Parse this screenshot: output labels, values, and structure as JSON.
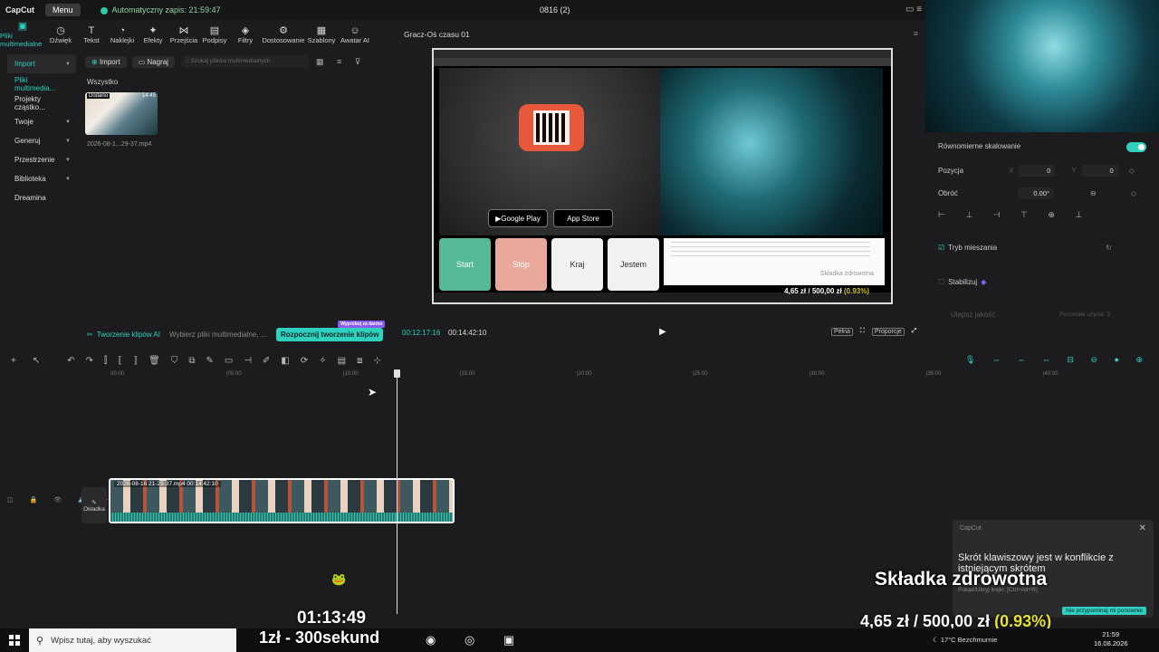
{
  "app": {
    "logo": "CapCut",
    "menu_label": "Menu",
    "autosave": "Automatyczny zapis: 21:59:47",
    "project_title": "0816 (2)"
  },
  "tool_tabs": [
    {
      "label": "Pliki multimedialne",
      "icon": "media-icon"
    },
    {
      "label": "Dźwięk",
      "icon": "audio-icon"
    },
    {
      "label": "Tekst",
      "icon": "text-icon"
    },
    {
      "label": "Naklejki",
      "icon": "sticker-icon"
    },
    {
      "label": "Efekty",
      "icon": "effects-icon"
    },
    {
      "label": "Przejścia",
      "icon": "transition-icon"
    },
    {
      "label": "Podpisy",
      "icon": "captions-icon"
    },
    {
      "label": "Filtry",
      "icon": "filter-icon"
    },
    {
      "label": "Dostosowanie",
      "icon": "adjust-icon"
    },
    {
      "label": "Szablony",
      "icon": "templates-icon"
    },
    {
      "label": "Awatar AI",
      "icon": "avatar-icon"
    }
  ],
  "left_nav": [
    {
      "label": "Import"
    },
    {
      "label": "Pliki multimedia..."
    },
    {
      "label": "Projekty cząstko..."
    },
    {
      "label": "Twoje"
    },
    {
      "label": "Generuj"
    },
    {
      "label": "Przestrzenie"
    },
    {
      "label": "Biblioteka"
    },
    {
      "label": "Dreamina"
    }
  ],
  "media": {
    "import_label": "Import",
    "record_label": "Nagraj",
    "search_placeholder": "Szukaj plików multimedialnych",
    "all_label": "Wszystko",
    "thumb_tag": "Dodano",
    "thumb_duration": "14:45",
    "thumb_name": "2026-08-1...29-37.mp4"
  },
  "ai_bar": {
    "title": "Tworzenie klipów AI",
    "desc": "Wybierz pliki multimedialne, ...",
    "button": "Rozpocznij tworzenie klipów",
    "badge": "Wypróbuj za darmo"
  },
  "player": {
    "title": "Gracz-Oś czasu 01",
    "current_time": "00:12:17:16",
    "total_time": "00:14:42:10",
    "ctrl_full": "Pełna",
    "ctrl_ratio": "Proporcje",
    "stream": {
      "buttons": [
        "Start",
        "Stop",
        "Kraj",
        "Jestem"
      ],
      "google_play": "Google Play",
      "app_store": "App Store",
      "chat_label": "Składka zdrowotna",
      "donation_amount": "4,65 zł / 500,00 zł",
      "donation_pct": "(0.93%)"
    }
  },
  "props": {
    "uniform_scale": "Równomierne skalowanie",
    "position_label": "Pozycja",
    "pos_x_label": "X",
    "pos_x": "0",
    "pos_y_label": "Y",
    "pos_y": "0",
    "rotate_label": "Obróć",
    "rotate_value": "0.00°",
    "blend_label": "Tryb mieszania",
    "stabilize_label": "Stabilizuj",
    "improve_label": "Ulepsz jakość",
    "remaining": "Pozostałe użycia: 3"
  },
  "ruler": [
    "00:00",
    "|05:00",
    "|10:00",
    "|15:00",
    "|20:00",
    "|25:00",
    "|30:00",
    "|35:00",
    "|40:00"
  ],
  "timeline": {
    "cover_label": "Okładka",
    "clip_label": "2026-08-16 21-29-37.mp4   00:14:42:10"
  },
  "notification": {
    "app": "CapCut",
    "text": "Skrót klawiszowy jest w konflikcie z istniejącym skrótem",
    "sub": "Pokaż/Ukryj linijki: [Ctrl+Alt+R]",
    "button": "Nie przypominaj mi ponownie"
  },
  "overlays": {
    "title": "Składka zdrowotna",
    "money": "4,65 zł / 500,00 zł",
    "money_pct": "(0.93%)",
    "timer": "01:13:49",
    "rate": "1zł - 300sekund"
  },
  "taskbar": {
    "search_placeholder": "Wpisz tutaj, aby wyszukać",
    "weather": "17°C  Bezchmurnie",
    "time": "21:59",
    "date": "16.08.2026"
  },
  "colors": {
    "accent": "#2fd0c0",
    "money_highlight": "#e6e02e"
  }
}
